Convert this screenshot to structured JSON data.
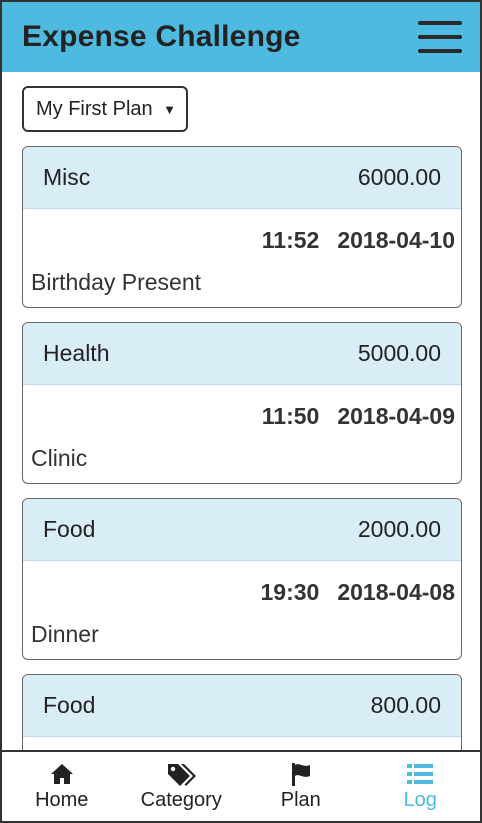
{
  "header": {
    "title": "Expense Challenge",
    "menu_icon": "hamburger-menu-icon",
    "background_color": "#4fbadf"
  },
  "plan_selector": {
    "selected": "My First Plan",
    "caret": "▼"
  },
  "expenses": [
    {
      "category": "Misc",
      "amount": "6000.00",
      "time": "11:52",
      "date": "2018-04-10",
      "note": "Birthday Present"
    },
    {
      "category": "Health",
      "amount": "5000.00",
      "time": "11:50",
      "date": "2018-04-09",
      "note": "Clinic"
    },
    {
      "category": "Food",
      "amount": "2000.00",
      "time": "19:30",
      "date": "2018-04-08",
      "note": "Dinner"
    },
    {
      "category": "Food",
      "amount": "800.00"
    }
  ],
  "tabbar": {
    "tabs": [
      {
        "label": "Home",
        "icon": "home-icon"
      },
      {
        "label": "Category",
        "icon": "tags-icon"
      },
      {
        "label": "Plan",
        "icon": "flag-icon"
      },
      {
        "label": "Log",
        "icon": "list-icon",
        "active": true
      }
    ],
    "active_color": "#4fbadf"
  }
}
